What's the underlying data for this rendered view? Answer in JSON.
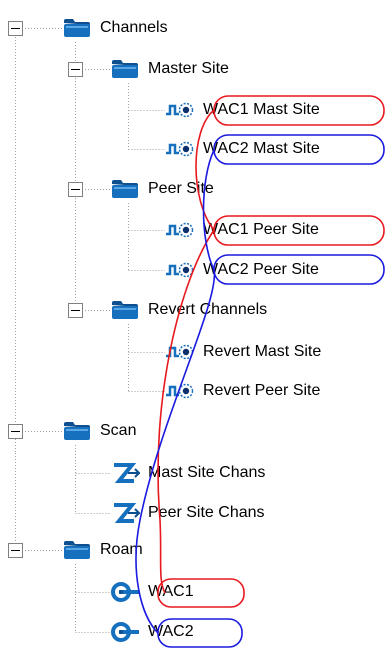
{
  "tree": {
    "channels": {
      "label": "Channels",
      "icon": "folder-icon",
      "expanded": true
    },
    "master_site": {
      "label": "Master Site",
      "icon": "folder-icon",
      "expanded": true
    },
    "wac1_mast_site": {
      "label": "WAC1 Mast Site",
      "icon": "channel-icon"
    },
    "wac2_mast_site": {
      "label": "WAC2 Mast Site",
      "icon": "channel-icon"
    },
    "peer_site": {
      "label": "Peer Site",
      "icon": "folder-icon",
      "expanded": true
    },
    "wac1_peer_site": {
      "label": "WAC1 Peer Site",
      "icon": "channel-icon"
    },
    "wac2_peer_site": {
      "label": "WAC2 Peer Site",
      "icon": "channel-icon"
    },
    "revert_channels": {
      "label": "Revert Channels",
      "icon": "folder-icon",
      "expanded": true
    },
    "revert_mast_site": {
      "label": "Revert Mast Site",
      "icon": "channel-icon"
    },
    "revert_peer_site": {
      "label": "Revert Peer Site",
      "icon": "channel-icon"
    },
    "scan": {
      "label": "Scan",
      "icon": "folder-icon",
      "expanded": true
    },
    "mast_site_chans": {
      "label": "Mast Site Chans",
      "icon": "scan-list-icon"
    },
    "peer_site_chans": {
      "label": "Peer Site Chans",
      "icon": "scan-list-icon"
    },
    "roam": {
      "label": "Roam",
      "icon": "folder-icon",
      "expanded": true
    },
    "wac1": {
      "label": "WAC1",
      "icon": "roam-icon"
    },
    "wac2": {
      "label": "WAC2",
      "icon": "roam-icon"
    }
  },
  "colors": {
    "highlight_red": "#e8191e",
    "highlight_blue": "#1a1ae0",
    "folder": "#1670bd",
    "tree_line": "#a0a0a0"
  }
}
